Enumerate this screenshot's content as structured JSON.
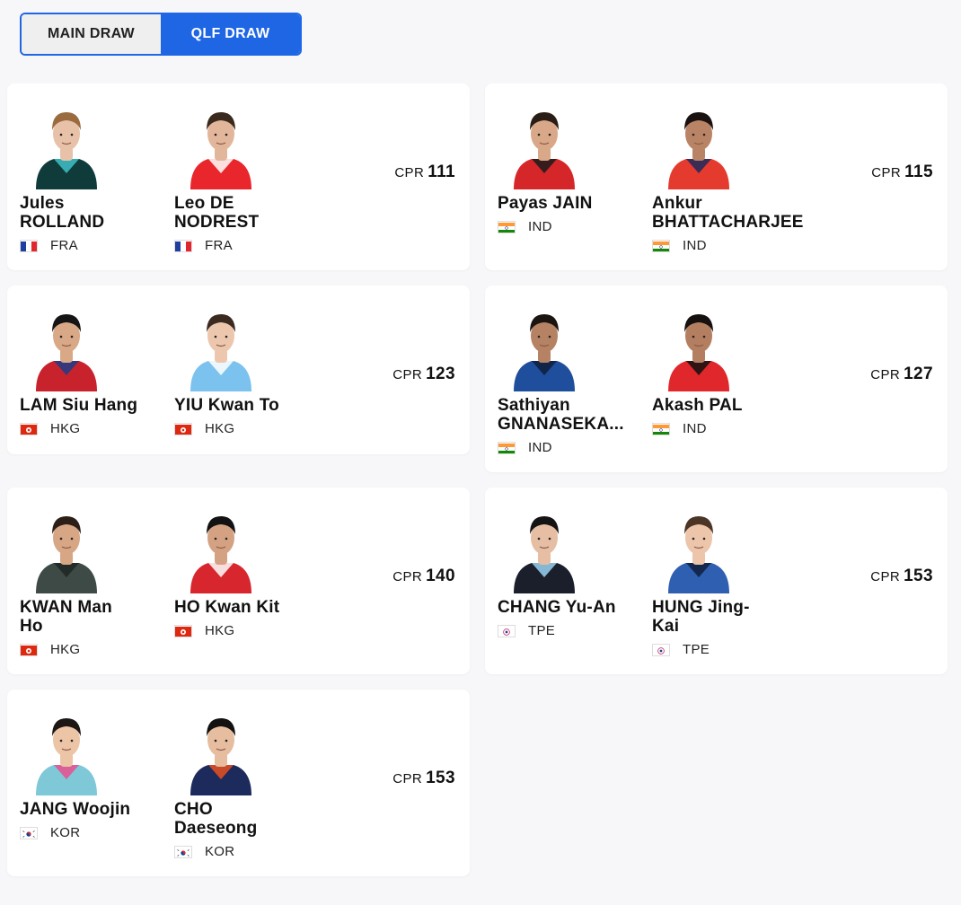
{
  "tabs": [
    {
      "label": "MAIN DRAW",
      "active": false
    },
    {
      "label": "QLF DRAW",
      "active": true
    }
  ],
  "cpr_label": "CPR",
  "matches": [
    {
      "cpr": "111",
      "players": [
        {
          "name_line1": "Jules",
          "name_line2": "ROLLAND",
          "country": "FRA",
          "shirt": "#0f3b3a",
          "shirt_accent": "#3fc1c9",
          "skin": "#e8c2a8",
          "hair": "#9a6b3e",
          "flag": "fra"
        },
        {
          "name_line1": "Leo DE",
          "name_line2": "NODREST",
          "country": "FRA",
          "shirt": "#e8262b",
          "shirt_accent": "#ffffff",
          "skin": "#e2b69a",
          "hair": "#3a2a1e",
          "flag": "fra"
        }
      ]
    },
    {
      "cpr": "115",
      "players": [
        {
          "name_line1": "Payas JAIN",
          "name_line2": "",
          "country": "IND",
          "shirt": "#d5272a",
          "shirt_accent": "#1b1b1b",
          "skin": "#d9a888",
          "hair": "#2a1d16",
          "flag": "ind"
        },
        {
          "name_line1": "Ankur",
          "name_line2": "BHATTACHARJEE",
          "country": "IND",
          "shirt": "#e53a2e",
          "shirt_accent": "#1c2a5c",
          "skin": "#b98466",
          "hair": "#1a1210",
          "flag": "ind"
        }
      ]
    },
    {
      "cpr": "123",
      "players": [
        {
          "name_line1": "LAM Siu Hang",
          "name_line2": "",
          "country": "HKG",
          "shirt": "#c8232c",
          "shirt_accent": "#1d3c8a",
          "skin": "#d8a887",
          "hair": "#151515",
          "flag": "hkg"
        },
        {
          "name_line1": "YIU Kwan To",
          "name_line2": "",
          "country": "HKG",
          "shirt": "#7cc2ef",
          "shirt_accent": "#ffffff",
          "skin": "#ecc7ad",
          "hair": "#3b2a20",
          "flag": "hkg"
        }
      ]
    },
    {
      "cpr": "127",
      "players": [
        {
          "name_line1": "Sathiyan",
          "name_line2": "GNANASEKA...",
          "country": "IND",
          "shirt": "#1e4e9c",
          "shirt_accent": "#0f1f3d",
          "skin": "#b58263",
          "hair": "#1b1512",
          "flag": "ind"
        },
        {
          "name_line1": "Akash PAL",
          "name_line2": "",
          "country": "IND",
          "shirt": "#e0282c",
          "shirt_accent": "#111111",
          "skin": "#b37f60",
          "hair": "#161110",
          "flag": "ind"
        }
      ]
    },
    {
      "cpr": "140",
      "players": [
        {
          "name_line1": "KWAN Man",
          "name_line2": "Ho",
          "country": "HKG",
          "shirt": "#3d4a45",
          "shirt_accent": "#1f2624",
          "skin": "#d7a685",
          "hair": "#2b1f18",
          "flag": "hkg"
        },
        {
          "name_line1": "HO Kwan Kit",
          "name_line2": "",
          "country": "HKG",
          "shirt": "#d7262d",
          "shirt_accent": "#ffffff",
          "skin": "#d4a283",
          "hair": "#121212",
          "flag": "hkg"
        }
      ]
    },
    {
      "cpr": "153",
      "players": [
        {
          "name_line1": "CHANG Yu-An",
          "name_line2": "",
          "country": "TPE",
          "shirt": "#1a1f2b",
          "shirt_accent": "#9ad3f5",
          "skin": "#e6bea3",
          "hair": "#141414",
          "flag": "tpe"
        },
        {
          "name_line1": "HUNG Jing-",
          "name_line2": "Kai",
          "country": "TPE",
          "shirt": "#2f5fb0",
          "shirt_accent": "#0f1f3d",
          "skin": "#ecc5aa",
          "hair": "#4a3526",
          "flag": "tpe"
        }
      ]
    },
    {
      "cpr": "153",
      "players": [
        {
          "name_line1": "JANG Woojin",
          "name_line2": "",
          "country": "KOR",
          "shirt": "#7ec8d8",
          "shirt_accent": "#e94d8e",
          "skin": "#ecc4a6",
          "hair": "#1c1714",
          "flag": "kor"
        },
        {
          "name_line1": "CHO",
          "name_line2": "Daeseong",
          "country": "KOR",
          "shirt": "#1c2a5c",
          "shirt_accent": "#e8501f",
          "skin": "#e6bd9f",
          "hair": "#141210",
          "flag": "kor"
        }
      ]
    }
  ]
}
